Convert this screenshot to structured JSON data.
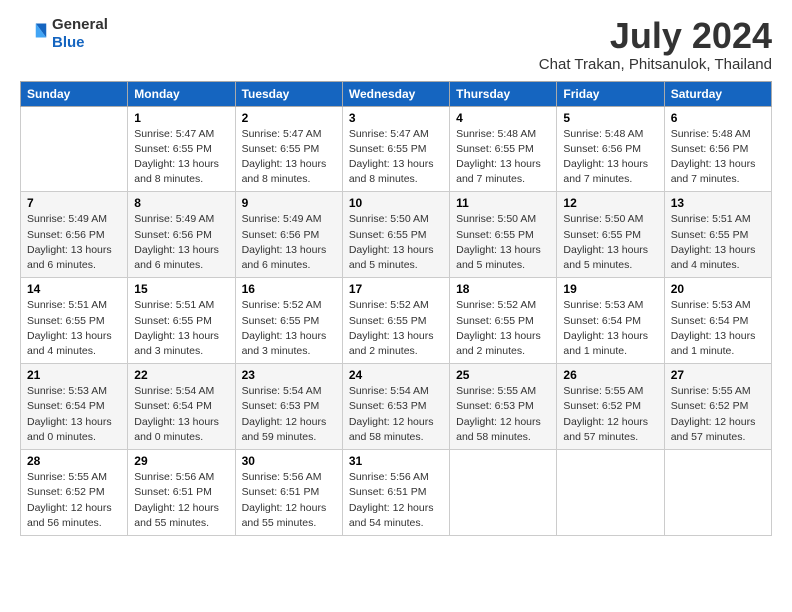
{
  "header": {
    "logo_general": "General",
    "logo_blue": "Blue",
    "title": "July 2024",
    "location": "Chat Trakan, Phitsanulok, Thailand"
  },
  "days_of_week": [
    "Sunday",
    "Monday",
    "Tuesday",
    "Wednesday",
    "Thursday",
    "Friday",
    "Saturday"
  ],
  "weeks": [
    [
      {
        "num": "",
        "info": ""
      },
      {
        "num": "1",
        "info": "Sunrise: 5:47 AM\nSunset: 6:55 PM\nDaylight: 13 hours\nand 8 minutes."
      },
      {
        "num": "2",
        "info": "Sunrise: 5:47 AM\nSunset: 6:55 PM\nDaylight: 13 hours\nand 8 minutes."
      },
      {
        "num": "3",
        "info": "Sunrise: 5:47 AM\nSunset: 6:55 PM\nDaylight: 13 hours\nand 8 minutes."
      },
      {
        "num": "4",
        "info": "Sunrise: 5:48 AM\nSunset: 6:55 PM\nDaylight: 13 hours\nand 7 minutes."
      },
      {
        "num": "5",
        "info": "Sunrise: 5:48 AM\nSunset: 6:56 PM\nDaylight: 13 hours\nand 7 minutes."
      },
      {
        "num": "6",
        "info": "Sunrise: 5:48 AM\nSunset: 6:56 PM\nDaylight: 13 hours\nand 7 minutes."
      }
    ],
    [
      {
        "num": "7",
        "info": "Sunrise: 5:49 AM\nSunset: 6:56 PM\nDaylight: 13 hours\nand 6 minutes."
      },
      {
        "num": "8",
        "info": "Sunrise: 5:49 AM\nSunset: 6:56 PM\nDaylight: 13 hours\nand 6 minutes."
      },
      {
        "num": "9",
        "info": "Sunrise: 5:49 AM\nSunset: 6:56 PM\nDaylight: 13 hours\nand 6 minutes."
      },
      {
        "num": "10",
        "info": "Sunrise: 5:50 AM\nSunset: 6:55 PM\nDaylight: 13 hours\nand 5 minutes."
      },
      {
        "num": "11",
        "info": "Sunrise: 5:50 AM\nSunset: 6:55 PM\nDaylight: 13 hours\nand 5 minutes."
      },
      {
        "num": "12",
        "info": "Sunrise: 5:50 AM\nSunset: 6:55 PM\nDaylight: 13 hours\nand 5 minutes."
      },
      {
        "num": "13",
        "info": "Sunrise: 5:51 AM\nSunset: 6:55 PM\nDaylight: 13 hours\nand 4 minutes."
      }
    ],
    [
      {
        "num": "14",
        "info": "Sunrise: 5:51 AM\nSunset: 6:55 PM\nDaylight: 13 hours\nand 4 minutes."
      },
      {
        "num": "15",
        "info": "Sunrise: 5:51 AM\nSunset: 6:55 PM\nDaylight: 13 hours\nand 3 minutes."
      },
      {
        "num": "16",
        "info": "Sunrise: 5:52 AM\nSunset: 6:55 PM\nDaylight: 13 hours\nand 3 minutes."
      },
      {
        "num": "17",
        "info": "Sunrise: 5:52 AM\nSunset: 6:55 PM\nDaylight: 13 hours\nand 2 minutes."
      },
      {
        "num": "18",
        "info": "Sunrise: 5:52 AM\nSunset: 6:55 PM\nDaylight: 13 hours\nand 2 minutes."
      },
      {
        "num": "19",
        "info": "Sunrise: 5:53 AM\nSunset: 6:54 PM\nDaylight: 13 hours\nand 1 minute."
      },
      {
        "num": "20",
        "info": "Sunrise: 5:53 AM\nSunset: 6:54 PM\nDaylight: 13 hours\nand 1 minute."
      }
    ],
    [
      {
        "num": "21",
        "info": "Sunrise: 5:53 AM\nSunset: 6:54 PM\nDaylight: 13 hours\nand 0 minutes."
      },
      {
        "num": "22",
        "info": "Sunrise: 5:54 AM\nSunset: 6:54 PM\nDaylight: 13 hours\nand 0 minutes."
      },
      {
        "num": "23",
        "info": "Sunrise: 5:54 AM\nSunset: 6:53 PM\nDaylight: 12 hours\nand 59 minutes."
      },
      {
        "num": "24",
        "info": "Sunrise: 5:54 AM\nSunset: 6:53 PM\nDaylight: 12 hours\nand 58 minutes."
      },
      {
        "num": "25",
        "info": "Sunrise: 5:55 AM\nSunset: 6:53 PM\nDaylight: 12 hours\nand 58 minutes."
      },
      {
        "num": "26",
        "info": "Sunrise: 5:55 AM\nSunset: 6:52 PM\nDaylight: 12 hours\nand 57 minutes."
      },
      {
        "num": "27",
        "info": "Sunrise: 5:55 AM\nSunset: 6:52 PM\nDaylight: 12 hours\nand 57 minutes."
      }
    ],
    [
      {
        "num": "28",
        "info": "Sunrise: 5:55 AM\nSunset: 6:52 PM\nDaylight: 12 hours\nand 56 minutes."
      },
      {
        "num": "29",
        "info": "Sunrise: 5:56 AM\nSunset: 6:51 PM\nDaylight: 12 hours\nand 55 minutes."
      },
      {
        "num": "30",
        "info": "Sunrise: 5:56 AM\nSunset: 6:51 PM\nDaylight: 12 hours\nand 55 minutes."
      },
      {
        "num": "31",
        "info": "Sunrise: 5:56 AM\nSunset: 6:51 PM\nDaylight: 12 hours\nand 54 minutes."
      },
      {
        "num": "",
        "info": ""
      },
      {
        "num": "",
        "info": ""
      },
      {
        "num": "",
        "info": ""
      }
    ]
  ]
}
